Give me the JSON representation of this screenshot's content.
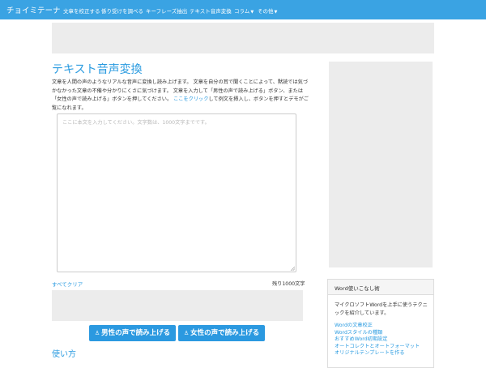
{
  "nav": {
    "brand": "チョイミテーナ",
    "items": [
      {
        "label": "文章を校正する"
      },
      {
        "label": "係り受けを調べる"
      },
      {
        "label": "キーフレーズ抽出"
      },
      {
        "label": "テキスト音声変換"
      },
      {
        "label": "コラム"
      },
      {
        "label": "その他"
      }
    ]
  },
  "main": {
    "title": "テキスト音声変換",
    "desc_1": "文章を人間の声のようなリアルな音声に変換し読み上げます。 文章を自分の耳で聞くことによって、黙読では気づかなかった文章の不備や分かりにくさに気づけます。 文章を入力して「男性の声で読み上げる」ボタン、または「女性の声で読み上げる」ボタンを押してください。",
    "desc_link": "ここをクリック",
    "desc_2": "して例文を挿入し、ボタンを押すとデモがご覧になれます。",
    "textarea_placeholder": "ここに本文を入力してください。文字数は、1000文字までです。",
    "clear_label": "すべてクリア",
    "remaining": "残り1000文字",
    "male_button": "男性の声で読み上げる",
    "female_button": "女性の声で読み上げる",
    "howto_title": "使い方"
  },
  "sidebar": {
    "panel_title": "Word使いこなし術",
    "panel_desc": "マイクロソフトWordを上手に使うテクニックを紹介しています。",
    "links": [
      {
        "label": "Wordの文章校正"
      },
      {
        "label": "Wordスタイルの種類"
      },
      {
        "label": "おすすめWord初期設定"
      },
      {
        "label": "オートコレクトとオートフォーマット"
      },
      {
        "label": "オリジナルテンプレートを作る"
      }
    ]
  },
  "colors": {
    "accent": "#3aa3e3",
    "link": "#2a9be0",
    "button": "#2b99e0",
    "ad_placeholder": "#ececec"
  },
  "icons": {
    "play_icon": "person-icon",
    "dropdown_icon": "caret-down-icon",
    "resize_icon": "resize-grip-icon"
  }
}
